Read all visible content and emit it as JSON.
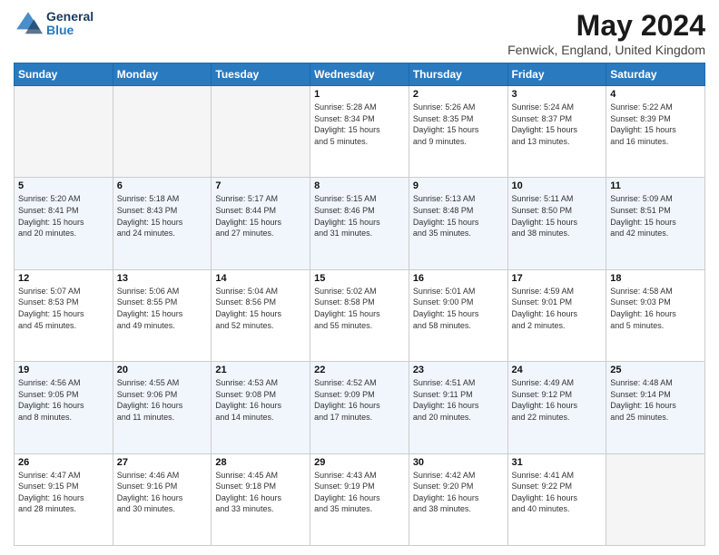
{
  "header": {
    "logo_general": "General",
    "logo_blue": "Blue",
    "month_title": "May 2024",
    "location": "Fenwick, England, United Kingdom"
  },
  "days_of_week": [
    "Sunday",
    "Monday",
    "Tuesday",
    "Wednesday",
    "Thursday",
    "Friday",
    "Saturday"
  ],
  "weeks": [
    [
      {
        "day": "",
        "info": ""
      },
      {
        "day": "",
        "info": ""
      },
      {
        "day": "",
        "info": ""
      },
      {
        "day": "1",
        "info": "Sunrise: 5:28 AM\nSunset: 8:34 PM\nDaylight: 15 hours\nand 5 minutes."
      },
      {
        "day": "2",
        "info": "Sunrise: 5:26 AM\nSunset: 8:35 PM\nDaylight: 15 hours\nand 9 minutes."
      },
      {
        "day": "3",
        "info": "Sunrise: 5:24 AM\nSunset: 8:37 PM\nDaylight: 15 hours\nand 13 minutes."
      },
      {
        "day": "4",
        "info": "Sunrise: 5:22 AM\nSunset: 8:39 PM\nDaylight: 15 hours\nand 16 minutes."
      }
    ],
    [
      {
        "day": "5",
        "info": "Sunrise: 5:20 AM\nSunset: 8:41 PM\nDaylight: 15 hours\nand 20 minutes."
      },
      {
        "day": "6",
        "info": "Sunrise: 5:18 AM\nSunset: 8:43 PM\nDaylight: 15 hours\nand 24 minutes."
      },
      {
        "day": "7",
        "info": "Sunrise: 5:17 AM\nSunset: 8:44 PM\nDaylight: 15 hours\nand 27 minutes."
      },
      {
        "day": "8",
        "info": "Sunrise: 5:15 AM\nSunset: 8:46 PM\nDaylight: 15 hours\nand 31 minutes."
      },
      {
        "day": "9",
        "info": "Sunrise: 5:13 AM\nSunset: 8:48 PM\nDaylight: 15 hours\nand 35 minutes."
      },
      {
        "day": "10",
        "info": "Sunrise: 5:11 AM\nSunset: 8:50 PM\nDaylight: 15 hours\nand 38 minutes."
      },
      {
        "day": "11",
        "info": "Sunrise: 5:09 AM\nSunset: 8:51 PM\nDaylight: 15 hours\nand 42 minutes."
      }
    ],
    [
      {
        "day": "12",
        "info": "Sunrise: 5:07 AM\nSunset: 8:53 PM\nDaylight: 15 hours\nand 45 minutes."
      },
      {
        "day": "13",
        "info": "Sunrise: 5:06 AM\nSunset: 8:55 PM\nDaylight: 15 hours\nand 49 minutes."
      },
      {
        "day": "14",
        "info": "Sunrise: 5:04 AM\nSunset: 8:56 PM\nDaylight: 15 hours\nand 52 minutes."
      },
      {
        "day": "15",
        "info": "Sunrise: 5:02 AM\nSunset: 8:58 PM\nDaylight: 15 hours\nand 55 minutes."
      },
      {
        "day": "16",
        "info": "Sunrise: 5:01 AM\nSunset: 9:00 PM\nDaylight: 15 hours\nand 58 minutes."
      },
      {
        "day": "17",
        "info": "Sunrise: 4:59 AM\nSunset: 9:01 PM\nDaylight: 16 hours\nand 2 minutes."
      },
      {
        "day": "18",
        "info": "Sunrise: 4:58 AM\nSunset: 9:03 PM\nDaylight: 16 hours\nand 5 minutes."
      }
    ],
    [
      {
        "day": "19",
        "info": "Sunrise: 4:56 AM\nSunset: 9:05 PM\nDaylight: 16 hours\nand 8 minutes."
      },
      {
        "day": "20",
        "info": "Sunrise: 4:55 AM\nSunset: 9:06 PM\nDaylight: 16 hours\nand 11 minutes."
      },
      {
        "day": "21",
        "info": "Sunrise: 4:53 AM\nSunset: 9:08 PM\nDaylight: 16 hours\nand 14 minutes."
      },
      {
        "day": "22",
        "info": "Sunrise: 4:52 AM\nSunset: 9:09 PM\nDaylight: 16 hours\nand 17 minutes."
      },
      {
        "day": "23",
        "info": "Sunrise: 4:51 AM\nSunset: 9:11 PM\nDaylight: 16 hours\nand 20 minutes."
      },
      {
        "day": "24",
        "info": "Sunrise: 4:49 AM\nSunset: 9:12 PM\nDaylight: 16 hours\nand 22 minutes."
      },
      {
        "day": "25",
        "info": "Sunrise: 4:48 AM\nSunset: 9:14 PM\nDaylight: 16 hours\nand 25 minutes."
      }
    ],
    [
      {
        "day": "26",
        "info": "Sunrise: 4:47 AM\nSunset: 9:15 PM\nDaylight: 16 hours\nand 28 minutes."
      },
      {
        "day": "27",
        "info": "Sunrise: 4:46 AM\nSunset: 9:16 PM\nDaylight: 16 hours\nand 30 minutes."
      },
      {
        "day": "28",
        "info": "Sunrise: 4:45 AM\nSunset: 9:18 PM\nDaylight: 16 hours\nand 33 minutes."
      },
      {
        "day": "29",
        "info": "Sunrise: 4:43 AM\nSunset: 9:19 PM\nDaylight: 16 hours\nand 35 minutes."
      },
      {
        "day": "30",
        "info": "Sunrise: 4:42 AM\nSunset: 9:20 PM\nDaylight: 16 hours\nand 38 minutes."
      },
      {
        "day": "31",
        "info": "Sunrise: 4:41 AM\nSunset: 9:22 PM\nDaylight: 16 hours\nand 40 minutes."
      },
      {
        "day": "",
        "info": ""
      }
    ]
  ]
}
